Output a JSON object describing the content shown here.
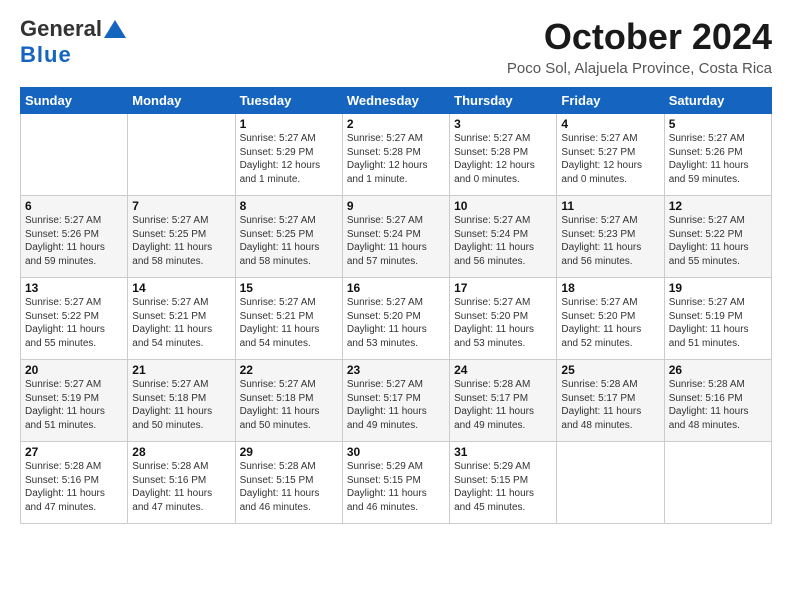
{
  "logo": {
    "line1": "General",
    "line2": "Blue"
  },
  "header": {
    "title": "October 2024",
    "subtitle": "Poco Sol, Alajuela Province, Costa Rica"
  },
  "days_of_week": [
    "Sunday",
    "Monday",
    "Tuesday",
    "Wednesday",
    "Thursday",
    "Friday",
    "Saturday"
  ],
  "weeks": [
    [
      {
        "day": "",
        "info": ""
      },
      {
        "day": "",
        "info": ""
      },
      {
        "day": "1",
        "info": "Sunrise: 5:27 AM\nSunset: 5:29 PM\nDaylight: 12 hours and 1 minute."
      },
      {
        "day": "2",
        "info": "Sunrise: 5:27 AM\nSunset: 5:28 PM\nDaylight: 12 hours and 1 minute."
      },
      {
        "day": "3",
        "info": "Sunrise: 5:27 AM\nSunset: 5:28 PM\nDaylight: 12 hours and 0 minutes."
      },
      {
        "day": "4",
        "info": "Sunrise: 5:27 AM\nSunset: 5:27 PM\nDaylight: 12 hours and 0 minutes."
      },
      {
        "day": "5",
        "info": "Sunrise: 5:27 AM\nSunset: 5:26 PM\nDaylight: 11 hours and 59 minutes."
      }
    ],
    [
      {
        "day": "6",
        "info": "Sunrise: 5:27 AM\nSunset: 5:26 PM\nDaylight: 11 hours and 59 minutes."
      },
      {
        "day": "7",
        "info": "Sunrise: 5:27 AM\nSunset: 5:25 PM\nDaylight: 11 hours and 58 minutes."
      },
      {
        "day": "8",
        "info": "Sunrise: 5:27 AM\nSunset: 5:25 PM\nDaylight: 11 hours and 58 minutes."
      },
      {
        "day": "9",
        "info": "Sunrise: 5:27 AM\nSunset: 5:24 PM\nDaylight: 11 hours and 57 minutes."
      },
      {
        "day": "10",
        "info": "Sunrise: 5:27 AM\nSunset: 5:24 PM\nDaylight: 11 hours and 56 minutes."
      },
      {
        "day": "11",
        "info": "Sunrise: 5:27 AM\nSunset: 5:23 PM\nDaylight: 11 hours and 56 minutes."
      },
      {
        "day": "12",
        "info": "Sunrise: 5:27 AM\nSunset: 5:22 PM\nDaylight: 11 hours and 55 minutes."
      }
    ],
    [
      {
        "day": "13",
        "info": "Sunrise: 5:27 AM\nSunset: 5:22 PM\nDaylight: 11 hours and 55 minutes."
      },
      {
        "day": "14",
        "info": "Sunrise: 5:27 AM\nSunset: 5:21 PM\nDaylight: 11 hours and 54 minutes."
      },
      {
        "day": "15",
        "info": "Sunrise: 5:27 AM\nSunset: 5:21 PM\nDaylight: 11 hours and 54 minutes."
      },
      {
        "day": "16",
        "info": "Sunrise: 5:27 AM\nSunset: 5:20 PM\nDaylight: 11 hours and 53 minutes."
      },
      {
        "day": "17",
        "info": "Sunrise: 5:27 AM\nSunset: 5:20 PM\nDaylight: 11 hours and 53 minutes."
      },
      {
        "day": "18",
        "info": "Sunrise: 5:27 AM\nSunset: 5:20 PM\nDaylight: 11 hours and 52 minutes."
      },
      {
        "day": "19",
        "info": "Sunrise: 5:27 AM\nSunset: 5:19 PM\nDaylight: 11 hours and 51 minutes."
      }
    ],
    [
      {
        "day": "20",
        "info": "Sunrise: 5:27 AM\nSunset: 5:19 PM\nDaylight: 11 hours and 51 minutes."
      },
      {
        "day": "21",
        "info": "Sunrise: 5:27 AM\nSunset: 5:18 PM\nDaylight: 11 hours and 50 minutes."
      },
      {
        "day": "22",
        "info": "Sunrise: 5:27 AM\nSunset: 5:18 PM\nDaylight: 11 hours and 50 minutes."
      },
      {
        "day": "23",
        "info": "Sunrise: 5:27 AM\nSunset: 5:17 PM\nDaylight: 11 hours and 49 minutes."
      },
      {
        "day": "24",
        "info": "Sunrise: 5:28 AM\nSunset: 5:17 PM\nDaylight: 11 hours and 49 minutes."
      },
      {
        "day": "25",
        "info": "Sunrise: 5:28 AM\nSunset: 5:17 PM\nDaylight: 11 hours and 48 minutes."
      },
      {
        "day": "26",
        "info": "Sunrise: 5:28 AM\nSunset: 5:16 PM\nDaylight: 11 hours and 48 minutes."
      }
    ],
    [
      {
        "day": "27",
        "info": "Sunrise: 5:28 AM\nSunset: 5:16 PM\nDaylight: 11 hours and 47 minutes."
      },
      {
        "day": "28",
        "info": "Sunrise: 5:28 AM\nSunset: 5:16 PM\nDaylight: 11 hours and 47 minutes."
      },
      {
        "day": "29",
        "info": "Sunrise: 5:28 AM\nSunset: 5:15 PM\nDaylight: 11 hours and 46 minutes."
      },
      {
        "day": "30",
        "info": "Sunrise: 5:29 AM\nSunset: 5:15 PM\nDaylight: 11 hours and 46 minutes."
      },
      {
        "day": "31",
        "info": "Sunrise: 5:29 AM\nSunset: 5:15 PM\nDaylight: 11 hours and 45 minutes."
      },
      {
        "day": "",
        "info": ""
      },
      {
        "day": "",
        "info": ""
      }
    ]
  ]
}
